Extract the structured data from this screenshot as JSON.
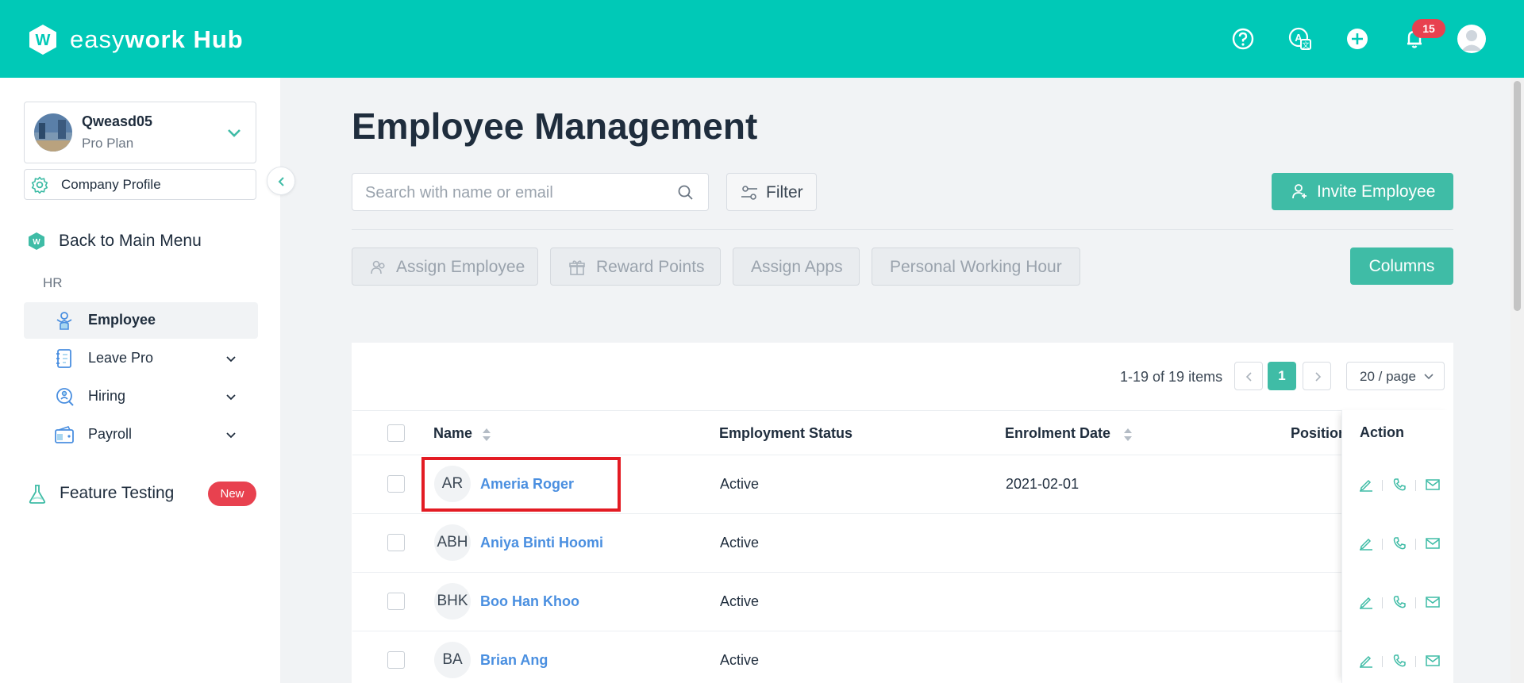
{
  "app": {
    "brand_light": "easy",
    "brand_bold": "work Hub",
    "notification_count": "15",
    "accent_color": "#3fbca6",
    "header_color": "#00c9b7"
  },
  "sidebar": {
    "workspace_name": "Qweasd05",
    "workspace_plan": "Pro Plan",
    "company_profile": "Company Profile",
    "back_to_main": "Back to Main Menu",
    "section_label": "HR",
    "items": [
      {
        "label": "Employee",
        "icon": "employee-icon",
        "active": true
      },
      {
        "label": "Leave Pro",
        "icon": "leave-icon",
        "expandable": true
      },
      {
        "label": "Hiring",
        "icon": "hiring-icon",
        "expandable": true
      },
      {
        "label": "Payroll",
        "icon": "payroll-icon",
        "expandable": true
      }
    ],
    "feature_testing": "Feature Testing",
    "new_badge": "New"
  },
  "main": {
    "title": "Employee Management",
    "search_placeholder": "Search with name or email",
    "filter_label": "Filter",
    "invite_label": "Invite Employee",
    "bulk_actions": [
      "Assign Employee",
      "Reward Points",
      "Assign Apps",
      "Personal Working Hour"
    ],
    "columns_label": "Columns"
  },
  "table": {
    "pagination_info": "1-19 of 19 items",
    "current_page": "1",
    "page_size": "20 / page",
    "headers": {
      "name": "Name",
      "status": "Employment Status",
      "enrolment": "Enrolment Date",
      "position": "Position",
      "action": "Action"
    },
    "rows": [
      {
        "initials": "AR",
        "name": "Ameria Roger",
        "status": "Active",
        "date": "2021-02-01"
      },
      {
        "initials": "ABH",
        "name": "Aniya Binti Hoomi",
        "status": "Active",
        "date": ""
      },
      {
        "initials": "BHK",
        "name": "Boo Han Khoo",
        "status": "Active",
        "date": ""
      },
      {
        "initials": "BA",
        "name": "Brian Ang",
        "status": "Active",
        "date": ""
      }
    ]
  }
}
